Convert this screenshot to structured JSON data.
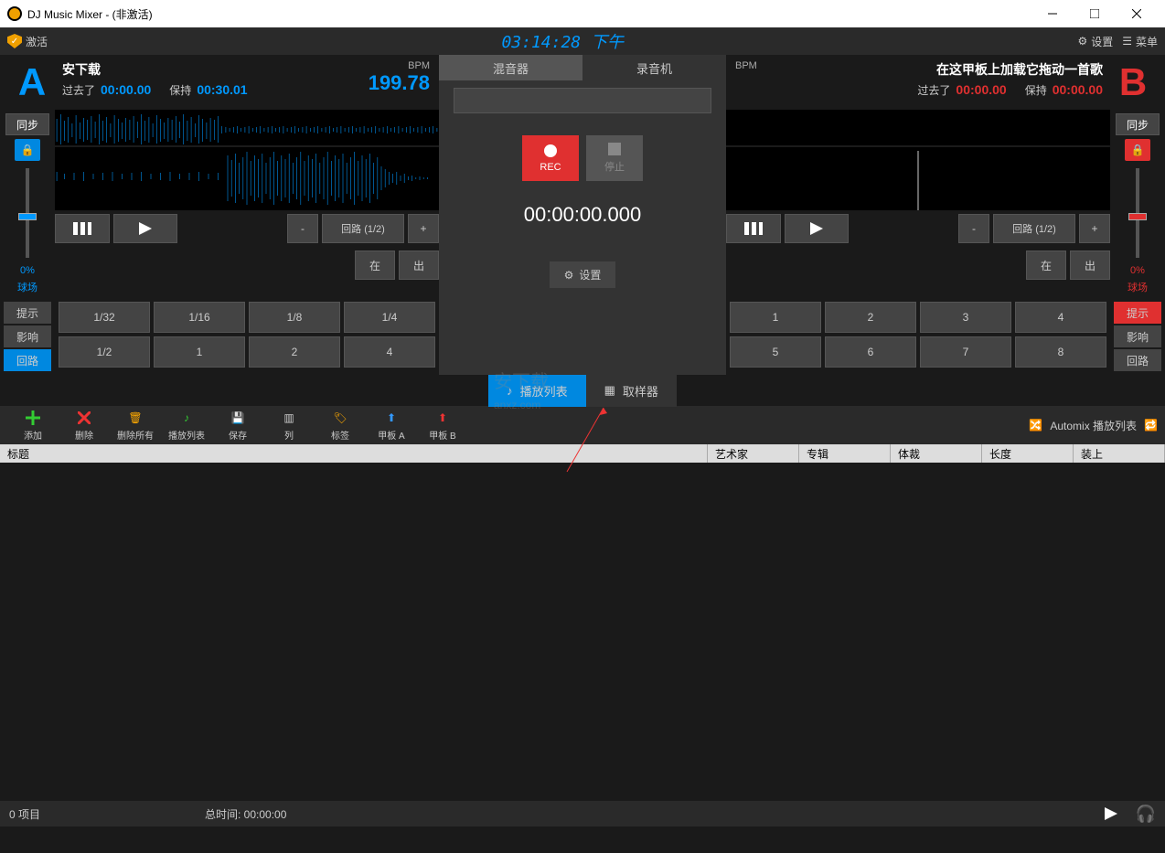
{
  "window": {
    "title": "DJ Music Mixer - (非激活)"
  },
  "topbar": {
    "activate": "激活",
    "clock": "03:14:28 下午",
    "settings": "设置",
    "menu": "菜单"
  },
  "deckA": {
    "letter": "A",
    "track": "安下载",
    "bpm_label": "BPM",
    "bpm": "199.78",
    "elapsed_label": "过去了",
    "elapsed": "00:00.00",
    "remain_label": "保持",
    "remain": "00:30.01",
    "sync": "同步",
    "pitch_pct": "0%",
    "pitch_lbl": "球场",
    "loop_label": "回路 (1/2)",
    "in": "在",
    "out": "出",
    "tabs": {
      "cue": "提示",
      "fx": "影响",
      "loop": "回路"
    },
    "pads_top": [
      "1/32",
      "1/16",
      "1/8",
      "1/4"
    ],
    "pads_bot": [
      "1/2",
      "1",
      "2",
      "4"
    ]
  },
  "deckB": {
    "letter": "B",
    "track": "在这甲板上加载它拖动一首歌",
    "bpm_label": "BPM",
    "bpm": "",
    "elapsed_label": "过去了",
    "elapsed": "00:00.00",
    "remain_label": "保持",
    "remain": "00:00.00",
    "sync": "同步",
    "pitch_pct": "0%",
    "pitch_lbl": "球场",
    "loop_label": "回路 (1/2)",
    "in": "在",
    "out": "出",
    "tabs": {
      "cue": "提示",
      "fx": "影响",
      "loop": "回路"
    },
    "pads_top": [
      "1",
      "2",
      "3",
      "4"
    ],
    "pads_bot": [
      "5",
      "6",
      "7",
      "8"
    ]
  },
  "center": {
    "tab_mixer": "混音器",
    "tab_rec": "录音机",
    "rec_label": "REC",
    "stop_label": "停止",
    "rec_time": "00:00:00.000",
    "settings": "设置"
  },
  "midtabs": {
    "playlist": "播放列表",
    "sampler": "取样器"
  },
  "toolbar": {
    "add": "添加",
    "delete": "删除",
    "delete_all": "删除所有",
    "playlist": "播放列表",
    "save": "保存",
    "columns": "列",
    "tags": "标签",
    "deck_a": "甲板 A",
    "deck_b": "甲板 B",
    "automix": "Automix 播放列表"
  },
  "table": {
    "title": "标题",
    "artist": "艺术家",
    "album": "专辑",
    "genre": "体裁",
    "length": "长度",
    "loaded": "装上"
  },
  "status": {
    "items": "0 项目",
    "total": "总时间: 00:00:00"
  }
}
